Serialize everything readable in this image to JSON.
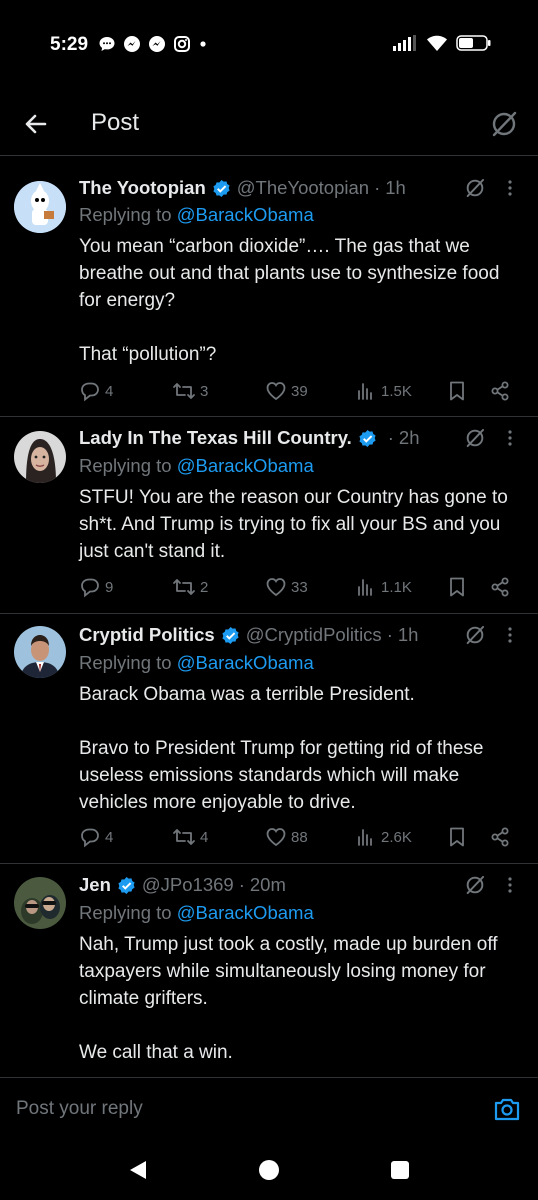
{
  "status_bar": {
    "time": "5:29",
    "icons_left": [
      "message-bubble-icon",
      "messenger-icon",
      "messenger-icon",
      "instagram-icon",
      "notification-dot-icon"
    ],
    "icons_right": [
      "signal-icon",
      "wifi-icon",
      "battery-icon"
    ]
  },
  "header": {
    "title": "Post",
    "back_icon": "back-arrow-icon",
    "grok_icon": "grok-icon"
  },
  "colors": {
    "background": "#000000",
    "text": "#e7e9ea",
    "muted": "#71767b",
    "accent": "#1d9bf0",
    "divider": "#2f3336"
  },
  "replies": [
    {
      "name": "The Yootopian",
      "verified": true,
      "handle": "@TheYootopian",
      "time": "1h",
      "replying_prefix": "Replying to",
      "replying_to": "@BarackObama",
      "text": "You mean “carbon dioxide”…. The gas that we breathe out and that plants use to synthesize food for energy?\n\nThat “pollution”?",
      "stats": {
        "replies": "4",
        "reposts": "3",
        "likes": "39",
        "views": "1.5K"
      }
    },
    {
      "name": "Lady In The Texas Hill Country.",
      "verified": true,
      "handle": "",
      "time": "2h",
      "replying_prefix": "Replying to",
      "replying_to": "@BarackObama",
      "text": "STFU! You are the reason our Country has gone to sh*t. And Trump is trying to fix all your BS and you just can't stand it.",
      "stats": {
        "replies": "9",
        "reposts": "2",
        "likes": "33",
        "views": "1.1K"
      }
    },
    {
      "name": "Cryptid Politics",
      "verified": true,
      "handle": "@CryptidPolitics",
      "time": "1h",
      "replying_prefix": "Replying to",
      "replying_to": "@BarackObama",
      "text": "Barack Obama was a terrible President.\n\nBravo to President Trump for getting rid of these useless emissions standards which will make vehicles more enjoyable to drive.",
      "stats": {
        "replies": "4",
        "reposts": "4",
        "likes": "88",
        "views": "2.6K"
      }
    },
    {
      "name": "Jen",
      "verified": true,
      "handle": "@JPo1369",
      "time": "20m",
      "replying_prefix": "Replying to",
      "replying_to": "@BarackObama",
      "text": "Nah, Trump just took a costly, made up burden off taxpayers while simultaneously losing money for climate grifters.\n\nWe call that a win.",
      "stats": null
    }
  ],
  "composer": {
    "placeholder": "Post your reply",
    "camera_icon": "camera-icon"
  },
  "nav_bar": {
    "icons": [
      "back-triangle-icon",
      "home-circle-icon",
      "recents-square-icon"
    ]
  }
}
